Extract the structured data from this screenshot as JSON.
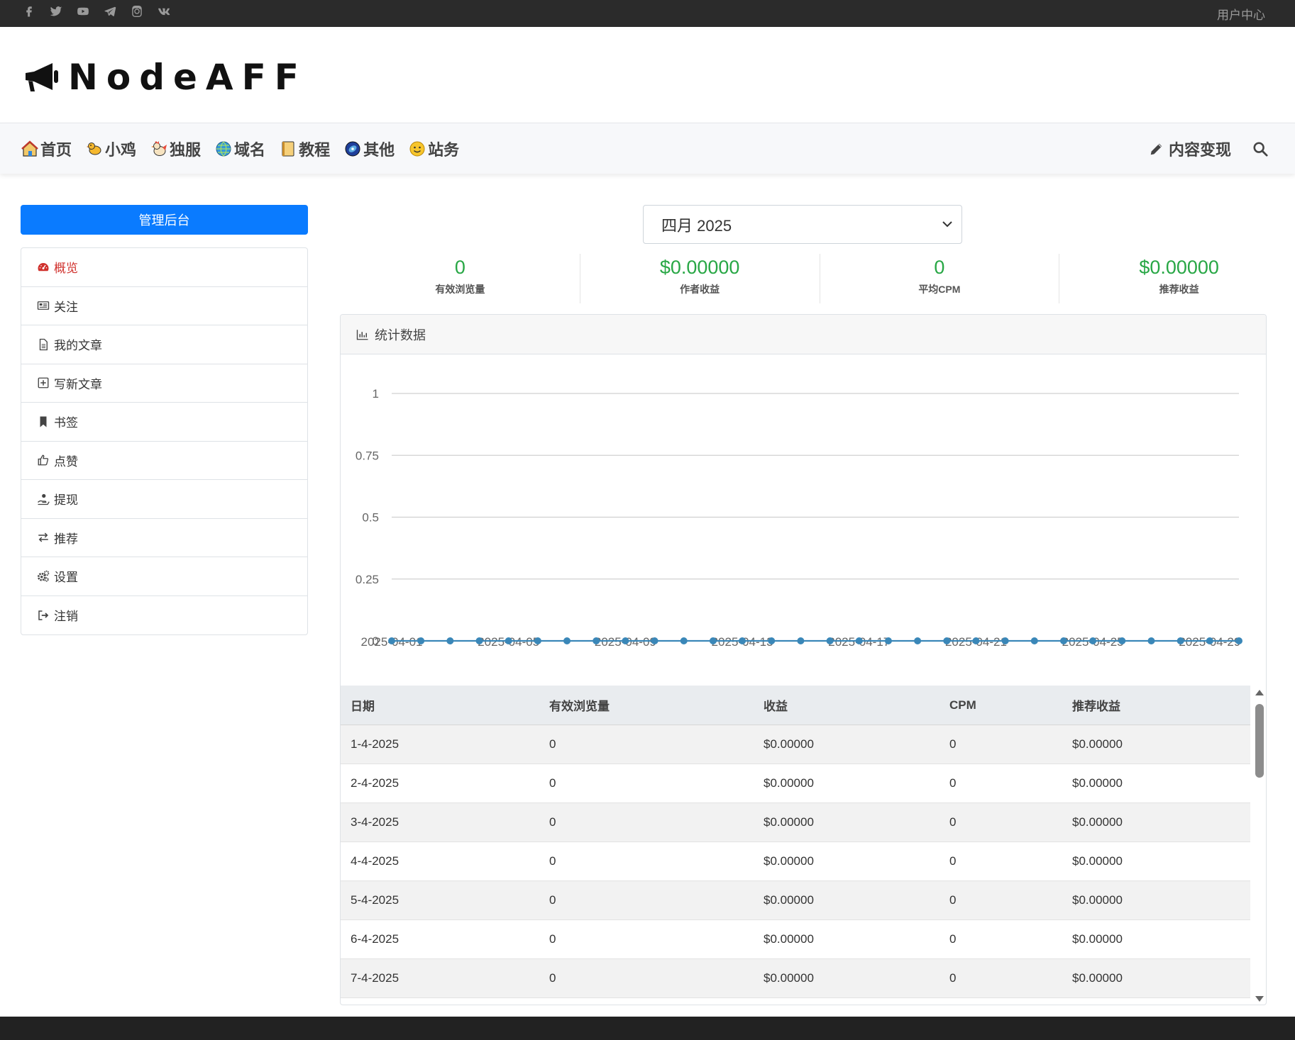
{
  "topbar": {
    "social_icons": [
      "facebook-icon",
      "twitter-icon",
      "youtube-icon",
      "telegram-icon",
      "instagram-icon",
      "vk-icon"
    ],
    "user_center": "用户中心"
  },
  "header": {
    "logo_text": "NodeAFF"
  },
  "nav": {
    "items": [
      {
        "label": "首页",
        "icon": "house-icon"
      },
      {
        "label": "小鸡",
        "icon": "chick-icon"
      },
      {
        "label": "独服",
        "icon": "rooster-icon"
      },
      {
        "label": "域名",
        "icon": "globe-icon"
      },
      {
        "label": "教程",
        "icon": "notebook-icon"
      },
      {
        "label": "其他",
        "icon": "disk-icon"
      },
      {
        "label": "站务",
        "icon": "smiley-icon"
      }
    ],
    "monetize_label": "内容变现"
  },
  "sidebar": {
    "admin_button": "管理后台",
    "items": [
      {
        "label": "概览",
        "icon": "dashboard-icon",
        "active": true
      },
      {
        "label": "关注",
        "icon": "newspaper-icon"
      },
      {
        "label": "我的文章",
        "icon": "file-icon"
      },
      {
        "label": "写新文章",
        "icon": "plus-square-icon"
      },
      {
        "label": "书签",
        "icon": "bookmark-icon"
      },
      {
        "label": "点赞",
        "icon": "thumbs-up-icon"
      },
      {
        "label": "提现",
        "icon": "hand-coin-icon"
      },
      {
        "label": "推荐",
        "icon": "exchange-icon"
      },
      {
        "label": "设置",
        "icon": "gears-icon"
      },
      {
        "label": "注销",
        "icon": "sign-out-icon"
      }
    ]
  },
  "month_select": {
    "value": "四月 2025"
  },
  "stats": [
    {
      "value": "0",
      "label": "有效浏览量"
    },
    {
      "value": "$0.00000",
      "label": "作者收益"
    },
    {
      "value": "0",
      "label": "平均CPM"
    },
    {
      "value": "$0.00000",
      "label": "推荐收益"
    }
  ],
  "card": {
    "title": "统计数据"
  },
  "colors": {
    "accent": "#0a7bff",
    "stat_green": "#28a745",
    "series": "#3a87b8",
    "active_red": "#d0312d"
  },
  "chart_data": {
    "type": "line",
    "x": [
      "2025-04-01",
      "2025-04-02",
      "2025-04-03",
      "2025-04-04",
      "2025-04-05",
      "2025-04-06",
      "2025-04-07",
      "2025-04-08",
      "2025-04-09",
      "2025-04-10",
      "2025-04-11",
      "2025-04-12",
      "2025-04-13",
      "2025-04-14",
      "2025-04-15",
      "2025-04-16",
      "2025-04-17",
      "2025-04-18",
      "2025-04-19",
      "2025-04-20",
      "2025-04-21",
      "2025-04-22",
      "2025-04-23",
      "2025-04-24",
      "2025-04-25",
      "2025-04-26",
      "2025-04-27",
      "2025-04-28",
      "2025-04-29",
      "2025-04-30"
    ],
    "xticks": [
      "2025-04-01",
      "2025-04-05",
      "2025-04-09",
      "2025-04-13",
      "2025-04-17",
      "2025-04-21",
      "2025-04-25",
      "2025-04-29"
    ],
    "series": [
      {
        "values": [
          0,
          0,
          0,
          0,
          0,
          0,
          0,
          0,
          0,
          0,
          0,
          0,
          0,
          0,
          0,
          0,
          0,
          0,
          0,
          0,
          0,
          0,
          0,
          0,
          0,
          0,
          0,
          0,
          0,
          0
        ]
      }
    ],
    "ylim": [
      0,
      1
    ],
    "yticks": [
      "0",
      "0.25",
      "0.5",
      "0.75",
      "1"
    ],
    "grid": true
  },
  "table": {
    "headers": [
      "日期",
      "有效浏览量",
      "收益",
      "CPM",
      "推荐收益"
    ],
    "rows": [
      [
        "1-4-2025",
        "0",
        "$0.00000",
        "0",
        "$0.00000"
      ],
      [
        "2-4-2025",
        "0",
        "$0.00000",
        "0",
        "$0.00000"
      ],
      [
        "3-4-2025",
        "0",
        "$0.00000",
        "0",
        "$0.00000"
      ],
      [
        "4-4-2025",
        "0",
        "$0.00000",
        "0",
        "$0.00000"
      ],
      [
        "5-4-2025",
        "0",
        "$0.00000",
        "0",
        "$0.00000"
      ],
      [
        "6-4-2025",
        "0",
        "$0.00000",
        "0",
        "$0.00000"
      ],
      [
        "7-4-2025",
        "0",
        "$0.00000",
        "0",
        "$0.00000"
      ]
    ]
  }
}
